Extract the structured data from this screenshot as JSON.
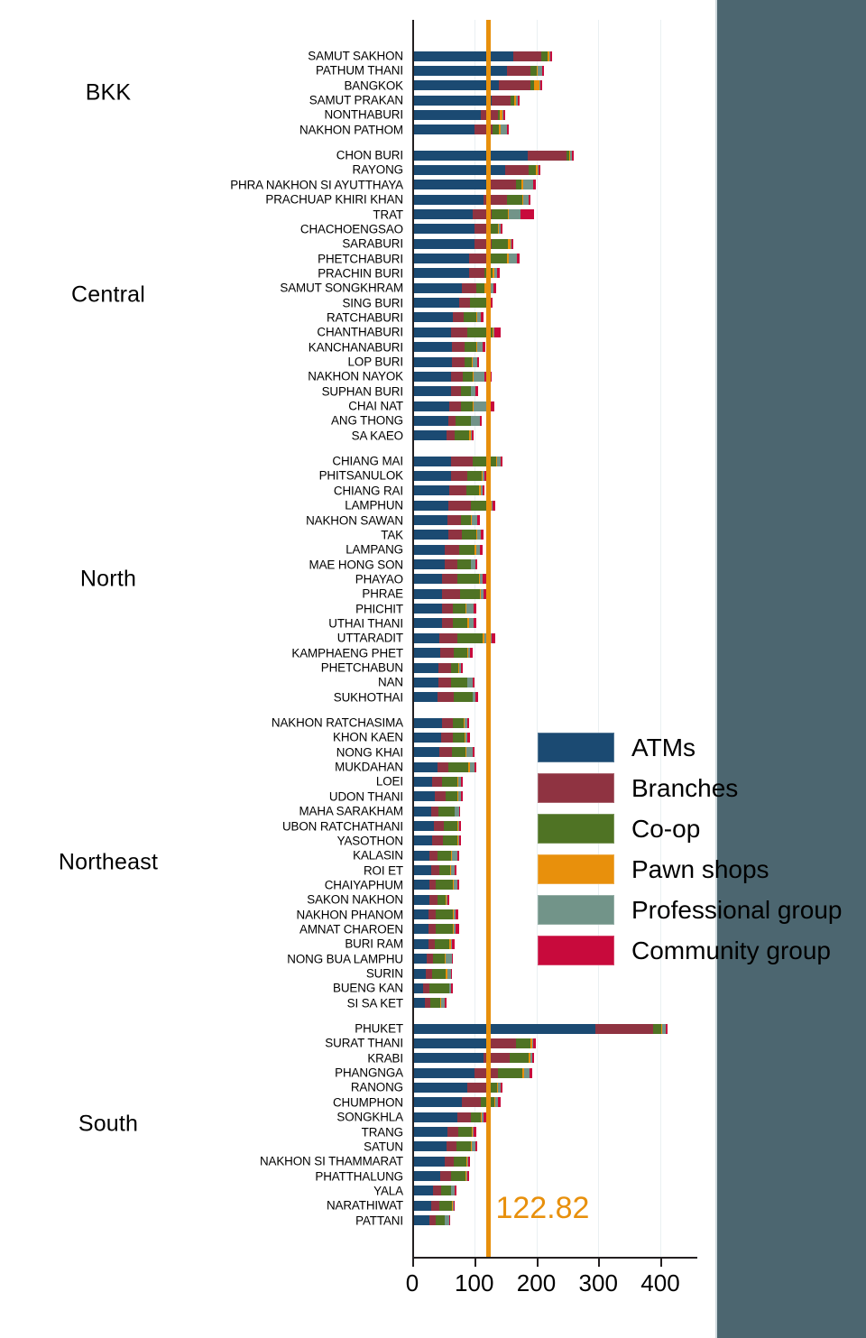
{
  "chart_data": {
    "type": "bar",
    "orientation": "horizontal",
    "stacked": true,
    "title": "",
    "xlabel": "",
    "ylabel": "",
    "xlim": [
      0,
      460
    ],
    "xticks": [
      0,
      100,
      200,
      300,
      400
    ],
    "xticklabels": [
      "0",
      "100",
      "200",
      "300",
      "400"
    ],
    "grid": true,
    "legend_position": "center-right",
    "series": [
      {
        "name": "ATMs",
        "color": "#1b4a72"
      },
      {
        "name": "Branches",
        "color": "#8f3341"
      },
      {
        "name": "Co-op",
        "color": "#4f7324"
      },
      {
        "name": "Pawn shops",
        "color": "#e8900c"
      },
      {
        "name": "Professional group",
        "color": "#729489"
      },
      {
        "name": "Community group",
        "color": "#c80a3c"
      }
    ],
    "reference_line": {
      "value": 122.82,
      "label": "122.82",
      "color": "#e8900c"
    },
    "region_labels": [
      "BKK",
      "Central",
      "North",
      "Northeast",
      "South"
    ],
    "groups": [
      {
        "region": "BKK",
        "rows": [
          {
            "label": "SAMUT SAKHON",
            "values": [
              163,
              45,
              10,
              3,
              2,
              2
            ],
            "total": 225
          },
          {
            "label": "PATHUM THANI",
            "values": [
              152,
              38,
              10,
              2,
              8,
              3
            ],
            "total": 213
          },
          {
            "label": "BANGKOK",
            "values": [
              140,
              50,
              6,
              9,
              1,
              3
            ],
            "total": 209
          },
          {
            "label": "SAMUT PRAKAN",
            "values": [
              128,
              30,
              7,
              2,
              3,
              3
            ],
            "total": 173
          },
          {
            "label": "NONTHABURI",
            "values": [
              110,
              28,
              3,
              4,
              2,
              3
            ],
            "total": 150
          },
          {
            "label": "NAKHON PATHOM",
            "values": [
              100,
              30,
              10,
              2,
              10,
              3
            ],
            "total": 155
          }
        ]
      },
      {
        "region": "Central",
        "rows": [
          {
            "label": "CHON BURI",
            "values": [
              186,
              62,
              5,
              2,
              2,
              4
            ],
            "total": 261
          },
          {
            "label": "RAYONG",
            "values": [
              150,
              38,
              11,
              3,
              2,
              3
            ],
            "total": 207
          },
          {
            "label": "PHRA NAKHON SI AYUTTHAYA",
            "values": [
              125,
              42,
              9,
              3,
              16,
              4
            ],
            "total": 199
          },
          {
            "label": "PRACHUAP KHIRI KHAN",
            "values": [
              115,
              38,
              24,
              2,
              8,
              4
            ],
            "total": 191
          },
          {
            "label": "TRAT",
            "values": [
              98,
              30,
              26,
              2,
              18,
              22
            ],
            "total": 196
          },
          {
            "label": "CHACHOENGSAO",
            "values": [
              100,
              22,
              16,
              2,
              2,
              3
            ],
            "total": 145
          },
          {
            "label": "SARABURI",
            "values": [
              100,
              28,
              26,
              4,
              2,
              3
            ],
            "total": 163
          },
          {
            "label": "PHETCHABURI",
            "values": [
              92,
              28,
              33,
              2,
              14,
              4
            ],
            "total": 173
          },
          {
            "label": "PRACHIN BURI",
            "values": [
              92,
              25,
              13,
              2,
              5,
              4
            ],
            "total": 141
          },
          {
            "label": "SAMUT SONGKHRAM",
            "values": [
              80,
              23,
              14,
              2,
              12,
              4
            ],
            "total": 135
          },
          {
            "label": "SING BURI",
            "values": [
              76,
              17,
              28,
              2,
              2,
              4
            ],
            "total": 129
          },
          {
            "label": "RATCHABURI",
            "values": [
              66,
              17,
              20,
              2,
              6,
              4
            ],
            "total": 115
          },
          {
            "label": "CHANTHABURI",
            "values": [
              63,
              26,
              40,
              2,
              2,
              10
            ],
            "total": 143
          },
          {
            "label": "KANCHANABURI",
            "values": [
              64,
              21,
              18,
              2,
              9,
              4
            ],
            "total": 118
          },
          {
            "label": "LOP BURI",
            "values": [
              64,
              20,
              12,
              2,
              6,
              4
            ],
            "total": 108
          },
          {
            "label": "NAKHON NAYOK",
            "values": [
              62,
              19,
              17,
              1,
              18,
              11
            ],
            "total": 128
          },
          {
            "label": "SUPHAN BURI",
            "values": [
              63,
              16,
              15,
              1,
              7,
              4
            ],
            "total": 106
          },
          {
            "label": "CHAI NAT",
            "values": [
              59,
              19,
              20,
              1,
              22,
              11
            ],
            "total": 132
          },
          {
            "label": "ANG THONG",
            "values": [
              58,
              12,
              24,
              1,
              14,
              3
            ],
            "total": 112
          },
          {
            "label": "SA KAEO",
            "values": [
              55,
              14,
              22,
              3,
              2,
              3
            ],
            "total": 99
          }
        ]
      },
      {
        "region": "North",
        "rows": [
          {
            "label": "CHIANG MAI",
            "values": [
              62,
              35,
              38,
              2,
              5,
              4
            ],
            "total": 146
          },
          {
            "label": "PHITSANULOK",
            "values": [
              62,
              27,
              23,
              2,
              2,
              4
            ],
            "total": 120
          },
          {
            "label": "CHIANG RAI",
            "values": [
              60,
              27,
              21,
              2,
              3,
              4
            ],
            "total": 117
          },
          {
            "label": "LAMPHUN",
            "values": [
              58,
              36,
              32,
              2,
              2,
              4
            ],
            "total": 134
          },
          {
            "label": "NAKHON SAWAN",
            "values": [
              56,
              22,
              16,
              2,
              9,
              4
            ],
            "total": 109
          },
          {
            "label": "TAK",
            "values": [
              58,
              22,
              23,
              2,
              6,
              4
            ],
            "total": 115
          },
          {
            "label": "LAMPANG",
            "values": [
              52,
              24,
              25,
              2,
              6,
              4
            ],
            "total": 113
          },
          {
            "label": "MAE HONG SON",
            "values": [
              52,
              20,
              22,
              1,
              7,
              3
            ],
            "total": 105
          },
          {
            "label": "PHAYAO",
            "values": [
              48,
              25,
              34,
              2,
              5,
              5
            ],
            "total": 119
          },
          {
            "label": "PHRAE",
            "values": [
              48,
              29,
              32,
              2,
              4,
              4
            ],
            "total": 119
          },
          {
            "label": "PHICHIT",
            "values": [
              48,
              18,
              20,
              1,
              12,
              4
            ],
            "total": 103
          },
          {
            "label": "UTHAI THANI",
            "values": [
              48,
              17,
              24,
              2,
              8,
              4
            ],
            "total": 103
          },
          {
            "label": "UTTARADIT",
            "values": [
              44,
              28,
              42,
              2,
              12,
              6
            ],
            "total": 134
          },
          {
            "label": "KAMPHAENG PHET",
            "values": [
              45,
              22,
              22,
              1,
              3,
              4
            ],
            "total": 97
          },
          {
            "label": "PHETCHABUN",
            "values": [
              42,
              20,
              12,
              1,
              3,
              3
            ],
            "total": 81
          },
          {
            "label": "NAN",
            "values": [
              42,
              20,
              26,
              1,
              8,
              3
            ],
            "total": 100
          },
          {
            "label": "SUKHOTHAI",
            "values": [
              40,
              27,
              30,
              1,
              4,
              4
            ],
            "total": 106
          }
        ]
      },
      {
        "region": "Northeast",
        "rows": [
          {
            "label": "NAKHON RATCHASIMA",
            "values": [
              48,
              18,
              17,
              2,
              3,
              3
            ],
            "total": 91
          },
          {
            "label": "KHON KAEN",
            "values": [
              46,
              20,
              18,
              2,
              3,
              4
            ],
            "total": 93
          },
          {
            "label": "NONG KHAI",
            "values": [
              44,
              20,
              22,
              1,
              11,
              2
            ],
            "total": 100
          },
          {
            "label": "MUKDAHAN",
            "values": [
              40,
              18,
              32,
              3,
              8,
              2
            ],
            "total": 103
          },
          {
            "label": "LOEI",
            "values": [
              32,
              16,
              24,
              2,
              5,
              2
            ],
            "total": 81
          },
          {
            "label": "UDON THANI",
            "values": [
              37,
              17,
              18,
              2,
              5,
              2
            ],
            "total": 81
          },
          {
            "label": "MAHA SARAKHAM",
            "values": [
              30,
              12,
              26,
              1,
              6,
              2
            ],
            "total": 77
          },
          {
            "label": "UBON RATCHATHANI",
            "values": [
              35,
              16,
              22,
              1,
              2,
              3
            ],
            "total": 79
          },
          {
            "label": "YASOTHON",
            "values": [
              32,
              17,
              24,
              1,
              2,
              3
            ],
            "total": 79
          },
          {
            "label": "KALASIN",
            "values": [
              28,
              13,
              22,
              1,
              9,
              2
            ],
            "total": 75
          },
          {
            "label": "ROI ET",
            "values": [
              30,
              13,
              18,
              1,
              7,
              2
            ],
            "total": 71
          },
          {
            "label": "CHAIYAPHUM",
            "values": [
              28,
              10,
              28,
              1,
              6,
              2
            ],
            "total": 75
          },
          {
            "label": "SAKON NAKHON",
            "values": [
              28,
              12,
              14,
              1,
              2,
              2
            ],
            "total": 59
          },
          {
            "label": "NAKHON PHANOM",
            "values": [
              26,
              12,
              28,
              1,
              3,
              4
            ],
            "total": 74
          },
          {
            "label": "AMNAT CHAROEN",
            "values": [
              26,
              12,
              28,
              1,
              3,
              6
            ],
            "total": 76
          },
          {
            "label": "BURI RAM",
            "values": [
              26,
              11,
              22,
              3,
              2,
              4
            ],
            "total": 68
          },
          {
            "label": "NONG BUA LAMPHU",
            "values": [
              23,
              10,
              20,
              1,
              10,
              2
            ],
            "total": 66
          },
          {
            "label": "SURIN",
            "values": [
              22,
              10,
              22,
              3,
              5,
              2
            ],
            "total": 64
          },
          {
            "label": "BUENG KAN",
            "values": [
              18,
              9,
              32,
              1,
              3,
              2
            ],
            "total": 65
          },
          {
            "label": "SI SA KET",
            "values": [
              20,
              9,
              16,
              1,
              7,
              2
            ],
            "total": 55
          }
        ]
      },
      {
        "region": "South",
        "rows": [
          {
            "label": "PHUKET",
            "values": [
              295,
              94,
              12,
              2,
              5,
              3
            ],
            "total": 411
          },
          {
            "label": "SURAT THANI",
            "values": [
              125,
              42,
              24,
              2,
              2,
              4
            ],
            "total": 199
          },
          {
            "label": "KRABI",
            "values": [
              115,
              42,
              30,
              3,
              3,
              4
            ],
            "total": 197
          },
          {
            "label": "PHANGNGA",
            "values": [
              100,
              38,
              40,
              2,
              9,
              4
            ],
            "total": 193
          },
          {
            "label": "RANONG",
            "values": [
              88,
              32,
              16,
              2,
              5,
              3
            ],
            "total": 146
          },
          {
            "label": "CHUMPHON",
            "values": [
              80,
              30,
              22,
              2,
              4,
              5
            ],
            "total": 143
          },
          {
            "label": "SONGKHLA",
            "values": [
              73,
              22,
              16,
              1,
              3,
              4
            ],
            "total": 119
          },
          {
            "label": "TRANG",
            "values": [
              57,
              17,
              22,
              1,
              2,
              4
            ],
            "total": 103
          },
          {
            "label": "SATUN",
            "values": [
              55,
              16,
              24,
              1,
              6,
              2
            ],
            "total": 104
          },
          {
            "label": "NAKHON SI THAMMARAT",
            "values": [
              52,
              15,
              20,
              1,
              2,
              3
            ],
            "total": 93
          },
          {
            "label": "PHATTHALUNG",
            "values": [
              45,
              17,
              24,
              1,
              2,
              3
            ],
            "total": 92
          },
          {
            "label": "YALA",
            "values": [
              33,
              13,
              16,
              1,
              6,
              2
            ],
            "total": 71
          },
          {
            "label": "NARATHIWAT",
            "values": [
              30,
              14,
              20,
              1,
              2,
              2
            ],
            "total": 69
          },
          {
            "label": "PATTANI",
            "values": [
              28,
              10,
              14,
              1,
              6,
              2
            ],
            "total": 61
          }
        ]
      }
    ]
  },
  "legend": {
    "items": [
      {
        "label": "ATMs",
        "color": "#1b4a72"
      },
      {
        "label": "Branches",
        "color": "#8f3341"
      },
      {
        "label": "Co-op",
        "color": "#4f7324"
      },
      {
        "label": "Pawn shops",
        "color": "#e8900c"
      },
      {
        "label": "Professional group",
        "color": "#729489"
      },
      {
        "label": "Community group",
        "color": "#c80a3c"
      }
    ]
  }
}
